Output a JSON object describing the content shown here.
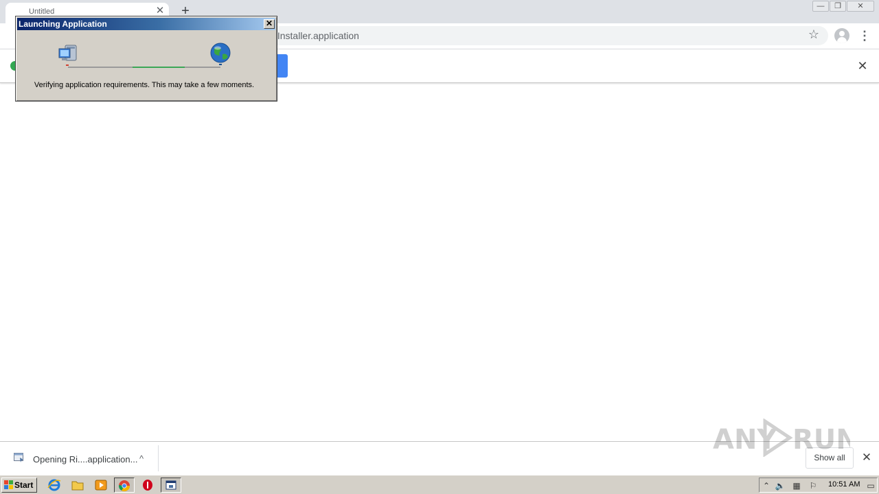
{
  "browser": {
    "tab_title": "Untitled",
    "tab_close_glyph": "✕",
    "new_tab_glyph": "+",
    "window_controls": [
      "—",
      "❐",
      "✕"
    ],
    "url_text": "v.Installer.application",
    "star_glyph": "☆",
    "menu_glyph": "⋮",
    "infobar_close_glyph": "✕"
  },
  "dialog": {
    "title": "Launching Application",
    "close_glyph": "✕",
    "message": "Verifying application requirements. This may take a few moments.",
    "progress_fraction": 0.34
  },
  "download_shelf": {
    "item_name": "Opening Ri....application...",
    "chevron_glyph": "^",
    "show_all_label": "Show all",
    "close_glyph": "✕"
  },
  "watermark": {
    "text": "ANY RUN"
  },
  "taskbar": {
    "start_label": "Start",
    "clock": "10:51 AM",
    "icons": [
      "internet-explorer-icon",
      "folder-icon",
      "media-player-icon",
      "chrome-icon",
      "stop-icon",
      "window-icon"
    ]
  },
  "colors": {
    "accent_blue": "#4285f4",
    "dialog_title_start": "#0a246a",
    "progress_green": "#3aa655"
  }
}
